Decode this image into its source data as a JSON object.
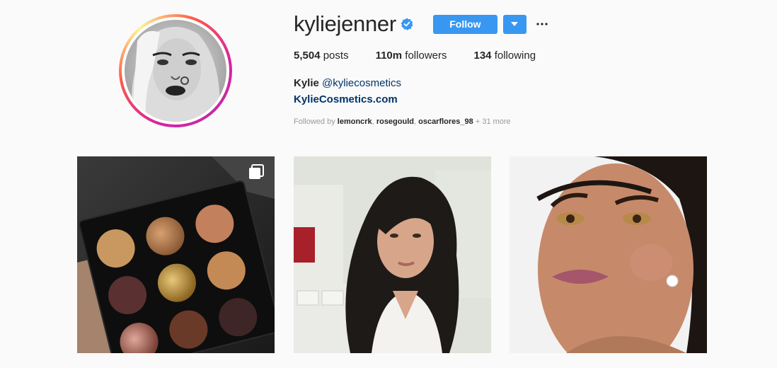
{
  "profile": {
    "username": "kyliejenner",
    "verified": true,
    "follow_label": "Follow",
    "more_icon": "ellipsis-icon",
    "stats": {
      "posts_count": "5,504",
      "posts_label": "posts",
      "followers_count": "110m",
      "followers_label": "followers",
      "following_count": "134",
      "following_label": "following"
    },
    "bio": {
      "name": "Kylie",
      "handle": "@kyliecosmetics",
      "link": "KylieCosmetics.com"
    },
    "followed_by": {
      "prefix": "Followed by",
      "users": [
        "lemoncrk",
        "rosegould",
        "oscarflores_98"
      ],
      "sep1": ",",
      "sep2": ",",
      "suffix": "+ 31 more"
    }
  },
  "colors": {
    "accent": "#3897f0",
    "link": "#003569",
    "background": "#fafafa"
  },
  "posts": [
    {
      "kind": "palette",
      "multi_icon": "multiple-images-icon"
    },
    {
      "kind": "selfie"
    },
    {
      "kind": "portrait"
    }
  ]
}
